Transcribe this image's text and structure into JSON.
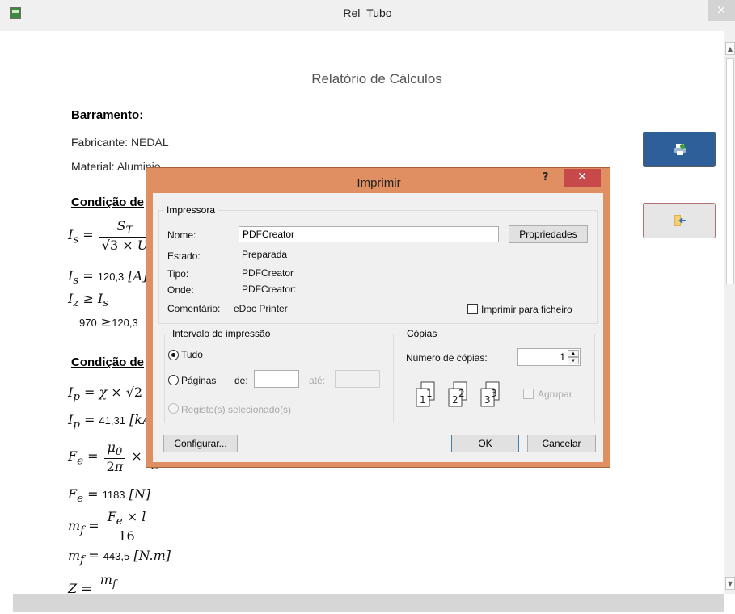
{
  "window": {
    "title": "Rel_Tubo",
    "close_glyph": "×"
  },
  "report": {
    "title": "Relatório de Cálculos",
    "section_barramento": "Barramento:",
    "fabricante_label": "Fabricante:",
    "fabricante_value": "NEDAL",
    "material_label": "Material:",
    "material_value": "Aluminio",
    "section_condicao1": "Condição de",
    "section_condicao2": "Condição de",
    "eq_is_val": "120,3",
    "eq_iz_val": "970",
    "eq_iz_cmp": "120,3",
    "eq_ip_val": "41,31",
    "eq_fe_val": "1183",
    "eq_fe_unit": "[N]",
    "eq_mf_val": "443,5",
    "eq_mf_unit": "[N.m]",
    "eq_mf_den": "16"
  },
  "side_buttons": {
    "print_icon": "printer-icon",
    "exit_icon": "exit-icon"
  },
  "dialog": {
    "title": "Imprimir",
    "help_glyph": "?",
    "close_glyph": "✕",
    "printer_group": "Impressora",
    "nome_label": "Nome:",
    "nome_value": "PDFCreator",
    "propriedades_button": "Propriedades",
    "estado_label": "Estado:",
    "estado_value": "Preparada",
    "tipo_label": "Tipo:",
    "tipo_value": "PDFCreator",
    "onde_label": "Onde:",
    "onde_value": "PDFCreator:",
    "comentario_label": "Comentário:",
    "comentario_value": "eDoc Printer",
    "imprimir_ficheiro_label": "Imprimir para ficheiro",
    "imprimir_ficheiro_checked": false,
    "range_group": "Intervalo de impressão",
    "tudo_label": "Tudo",
    "paginas_label": "Páginas",
    "de_label": "de:",
    "ate_label": "até:",
    "registo_label": "Registo(s) selecionado(s)",
    "copies_group": "Cópias",
    "num_copias_label": "Número de cópias:",
    "num_copias_value": "1",
    "agrupar_label": "Agrupar",
    "configurar_button": "Configurar...",
    "ok_button": "OK",
    "cancelar_button": "Cancelar"
  }
}
